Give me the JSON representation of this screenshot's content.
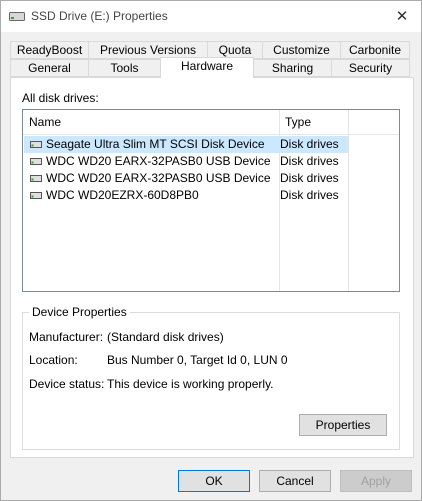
{
  "window": {
    "title": "SSD Drive (E:) Properties"
  },
  "tabs_row1": [
    "ReadyBoost",
    "Previous Versions",
    "Quota",
    "Customize",
    "Carbonite"
  ],
  "tabs_row2": [
    "General",
    "Tools",
    "Hardware",
    "Sharing",
    "Security"
  ],
  "active_tab": "Hardware",
  "hardware": {
    "all_disk_drives_label": "All disk drives:",
    "columns": {
      "name": "Name",
      "type": "Type"
    },
    "drives": [
      {
        "name": "Seagate Ultra Slim MT SCSI Disk Device",
        "type": "Disk drives",
        "selected": true
      },
      {
        "name": "WDC WD20 EARX-32PASB0 USB Device",
        "type": "Disk drives",
        "selected": false
      },
      {
        "name": "WDC WD20 EARX-32PASB0 USB Device",
        "type": "Disk drives",
        "selected": false
      },
      {
        "name": "WDC WD20EZRX-60D8PB0",
        "type": "Disk drives",
        "selected": false
      }
    ],
    "device_properties": {
      "title": "Device Properties",
      "manufacturer_label": "Manufacturer:",
      "manufacturer_value": "(Standard disk drives)",
      "location_label": "Location:",
      "location_value": "Bus Number 0, Target Id 0, LUN 0",
      "status_label": "Device status:",
      "status_value": "This device is working properly.",
      "properties_button": "Properties"
    }
  },
  "footer": {
    "ok": "OK",
    "cancel": "Cancel",
    "apply": "Apply"
  },
  "colors": {
    "selection": "#cce8ff",
    "default_button_border": "#0078d7"
  }
}
